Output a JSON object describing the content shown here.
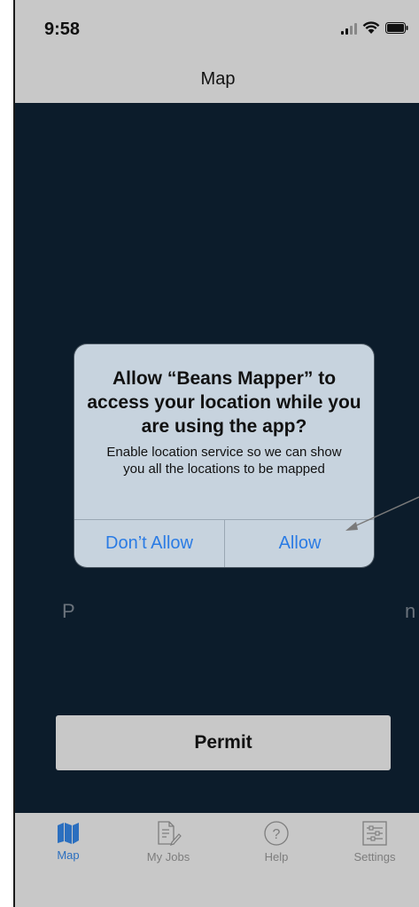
{
  "status_bar": {
    "time": "9:58"
  },
  "navbar": {
    "title": "Map"
  },
  "content": {
    "background_fragment_left": "P",
    "background_fragment_right": "n",
    "permit_button_label": "Permit"
  },
  "alert": {
    "title": "Allow “Beans Mapper” to access your location while you are using the app?",
    "message": "Enable location service so we can show you all the locations to be mapped",
    "dont_allow_label": "Don’t Allow",
    "allow_label": "Allow"
  },
  "tabbar": {
    "tabs": [
      {
        "label": "Map",
        "icon": "map-icon",
        "active": true
      },
      {
        "label": "My Jobs",
        "icon": "document-edit-icon",
        "active": false
      },
      {
        "label": "Help",
        "icon": "question-circle-icon",
        "active": false
      },
      {
        "label": "Settings",
        "icon": "sliders-icon",
        "active": false
      }
    ]
  },
  "colors": {
    "content_bg": "#0c1c2b",
    "chrome_bg": "#c8c8c8",
    "alert_bg": "#c7d3de",
    "link_blue": "#2a7be4",
    "tab_active": "#2b6fbf"
  }
}
